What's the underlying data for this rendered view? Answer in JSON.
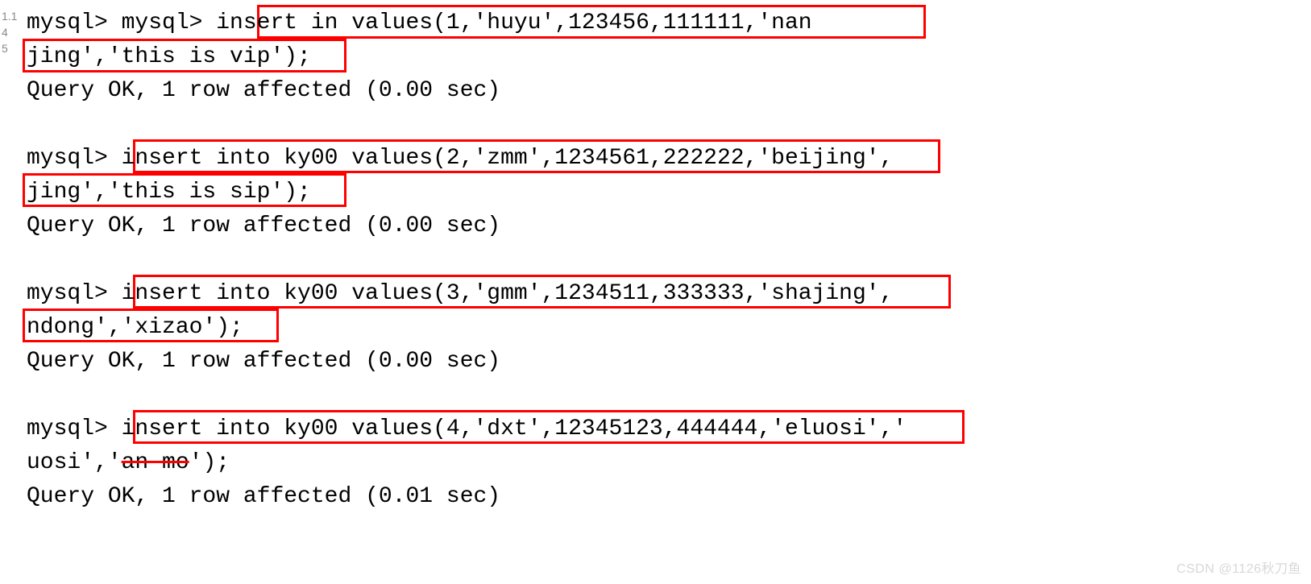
{
  "lineNumbers": {
    "a": "1.1",
    "b": "4",
    "c": "5"
  },
  "lines": {
    "l1": "mysql> mysql> insert in values(1,'huyu',123456,111111,'nan",
    "l2": "jing','this is vip');",
    "l3": "Query OK, 1 row affected (0.00 sec)",
    "l5": "mysql> insert into ky00 values(2,'zmm',1234561,222222,'beijing',",
    "l6": "jing','this is sip');",
    "l7": "Query OK, 1 row affected (0.00 sec)",
    "l9": "mysql> insert into ky00 values(3,'gmm',1234511,333333,'shajing',",
    "l10": "ndong','xizao');",
    "l11": "Query OK, 1 row affected (0.00 sec)",
    "l13": "mysql> insert into ky00 values(4,'dxt',12345123,444444,'eluosi','",
    "l14a": "uosi','",
    "l14b": "an mo",
    "l14c": "');",
    "l15": "Query OK, 1 row affected (0.01 sec)"
  },
  "watermark": "CSDN @1126秋刀鱼"
}
